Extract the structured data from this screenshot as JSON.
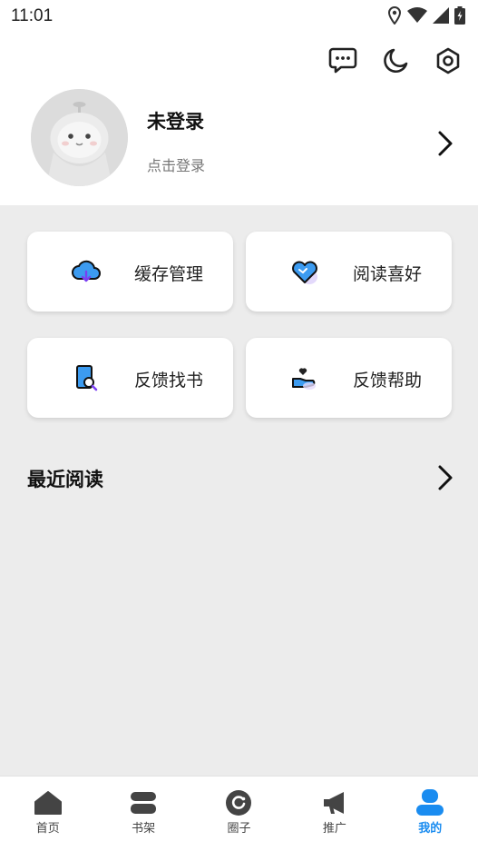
{
  "status_bar": {
    "time": "11:01",
    "icons": [
      "location-icon",
      "wifi-icon",
      "signal-icon",
      "battery-icon"
    ]
  },
  "header": {
    "actions": [
      "message-icon",
      "night-mode-icon",
      "settings-icon"
    ],
    "profile": {
      "name": "未登录",
      "subtitle": "点击登录"
    }
  },
  "features": [
    {
      "label": "缓存管理",
      "icon": "cloud-download-icon"
    },
    {
      "label": "阅读喜好",
      "icon": "heart-icon"
    },
    {
      "label": "反馈找书",
      "icon": "search-book-icon"
    },
    {
      "label": "反馈帮助",
      "icon": "hand-heart-icon"
    }
  ],
  "recent": {
    "title": "最近阅读"
  },
  "bottom_nav": {
    "items": [
      {
        "label": "首页",
        "icon": "home-icon",
        "active": false
      },
      {
        "label": "书架",
        "icon": "bookshelf-icon",
        "active": false
      },
      {
        "label": "圈子",
        "icon": "circle-icon",
        "active": false
      },
      {
        "label": "推广",
        "icon": "megaphone-icon",
        "active": false
      },
      {
        "label": "我的",
        "icon": "user-icon",
        "active": true
      }
    ]
  },
  "colors": {
    "accent": "#1a8cf0",
    "background": "#ececec",
    "card": "#ffffff"
  }
}
